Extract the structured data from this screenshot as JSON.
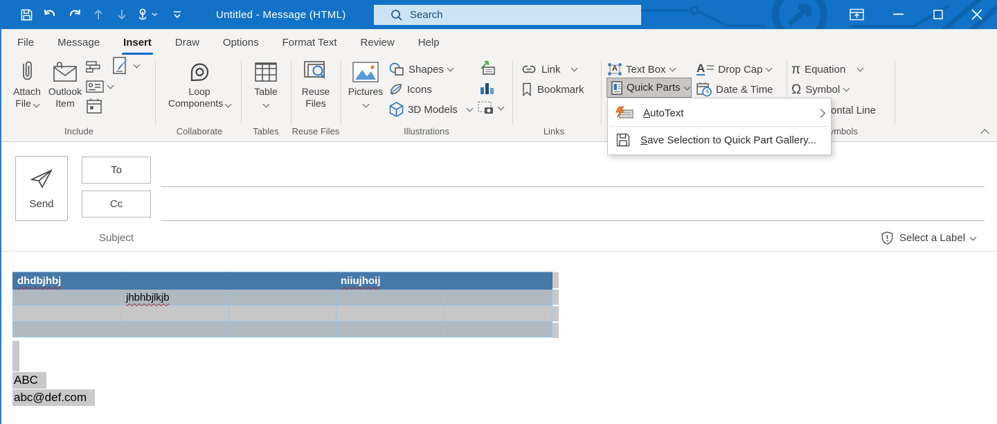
{
  "titlebar": {
    "title": "Untitled - Message (HTML)",
    "search_placeholder": "Search"
  },
  "tabs": [
    {
      "label": "File"
    },
    {
      "label": "Message"
    },
    {
      "label": "Insert",
      "active": true
    },
    {
      "label": "Draw"
    },
    {
      "label": "Options"
    },
    {
      "label": "Format Text"
    },
    {
      "label": "Review"
    },
    {
      "label": "Help"
    }
  ],
  "ribbon": {
    "attach_file": {
      "line1": "Attach",
      "line2": "File"
    },
    "outlook_item": {
      "line1": "Outlook",
      "line2": "Item"
    },
    "loop_components": {
      "line1": "Loop",
      "line2": "Components"
    },
    "table_label": "Table",
    "reuse_files": {
      "line1": "Reuse",
      "line2": "Files"
    },
    "pictures_label": "Pictures",
    "shapes_label": "Shapes",
    "icons_label": "Icons",
    "models_label": "3D Models",
    "link_label": "Link",
    "bookmark_label": "Bookmark",
    "text_box_label": "Text Box",
    "quick_parts_label": "Quick Parts",
    "drop_cap_label": "Drop Cap",
    "date_time_label": "Date & Time",
    "horizontal_line_label": "Horizontal Line",
    "equation_label": "Equation",
    "symbol_label": "Symbol",
    "glyphs": {
      "equation": "π",
      "symbol": "Ω",
      "drop_cap": "A",
      "text_box": "A"
    },
    "group_labels": {
      "include": "Include",
      "collaborate": "Collaborate",
      "tables": "Tables",
      "reuse_files": "Reuse Files",
      "illustrations": "Illustrations",
      "links": "Links",
      "symbols": "Symbols"
    }
  },
  "quick_parts_menu": {
    "items": [
      {
        "accel": "A",
        "rest": "utoText",
        "has_submenu": true
      },
      {
        "accel": "S",
        "rest": "ave Selection to Quick Part Gallery..."
      }
    ]
  },
  "compose": {
    "send_label": "Send",
    "to_label": "To",
    "cc_label": "Cc",
    "subject_label": "Subject",
    "sensitivity_label": "Select a Label"
  },
  "editor": {
    "table": {
      "header_row": [
        "dhdbjhbj",
        "",
        "",
        "niiujhoij",
        ""
      ],
      "rows": [
        [
          "",
          "jhbhbjlkjb",
          "",
          "",
          ""
        ],
        [
          "",
          "",
          "",
          "",
          ""
        ],
        [
          "",
          "",
          "",
          "",
          ""
        ]
      ]
    },
    "text_lines": [
      "ABC",
      "abc@def.com"
    ]
  },
  "colors": {
    "titlebar_bg": "#1272c8",
    "accent": "#1168c4",
    "search_bg": "#cde4f7",
    "search_fg": "#1b4e79",
    "ribbon_bg": "#f4f3f2",
    "pressed_button_bg": "#c8c6c4",
    "table_header_bg": "#4678a8",
    "table_row_gray_blue": "#aeb9c2",
    "table_row_gray": "#c7c7c7",
    "table_border": "#9cc3e5",
    "selection_highlight": "#c9c9c9"
  }
}
